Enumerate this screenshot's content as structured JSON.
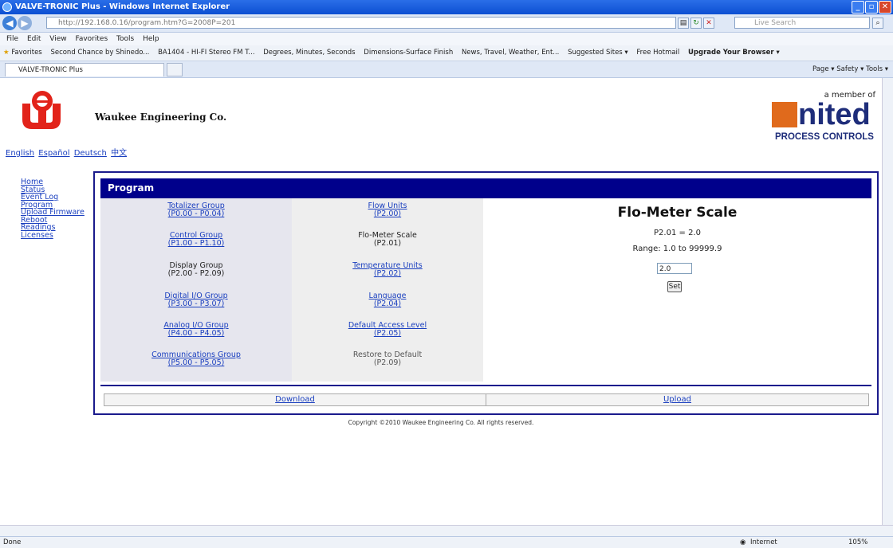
{
  "window": {
    "title": "VALVE-TRONIC Plus - Windows Internet Explorer",
    "address": "http://192.168.0.16/program.htm?G=2008P=201",
    "search_placeholder": "Live Search"
  },
  "menu": [
    "File",
    "Edit",
    "View",
    "Favorites",
    "Tools",
    "Help"
  ],
  "favorites": {
    "label": "Favorites",
    "items": [
      "Second Chance by Shinedo...",
      "BA1404 - HI-FI Stereo FM T...",
      "Degrees, Minutes, Seconds",
      "Dimensions-Surface Finish",
      "News, Travel, Weather, Ent...",
      "Suggested Sites ▾",
      "Free Hotmail",
      "Upgrade Your Browser ▾"
    ]
  },
  "tab": {
    "label": "VALVE-TRONIC Plus"
  },
  "command_bar": "Page ▾  Safety ▾  Tools ▾",
  "header": {
    "company": "Waukee Engineering Co.",
    "member_of": "a member of",
    "partner_word": "nited",
    "partner_sub": "PROCESS CONTROLS",
    "languages": [
      "English",
      "Español",
      "Deutsch",
      "中文"
    ]
  },
  "sidenav": [
    "Home",
    "Status",
    "Event Log",
    "Program",
    "Upload Firmware",
    "Reboot",
    "Readings",
    "Licenses"
  ],
  "program": {
    "title": "Program",
    "groups": [
      {
        "name": "Totalizer Group",
        "range": "(P0.00 - P0.04)"
      },
      {
        "name": "Control Group",
        "range": "(P1.00 - P1.10)"
      },
      {
        "name": "Display Group",
        "range": "(P2.00 - P2.09)"
      },
      {
        "name": "Digital I/O Group",
        "range": "(P3.00 - P3.07)"
      },
      {
        "name": "Analog I/O Group",
        "range": "(P4.00 - P4.05)"
      },
      {
        "name": "Communications Group",
        "range": "(P5.00 - P5.05)"
      }
    ],
    "params": [
      {
        "name": "Flow Units",
        "code": "(P2.00)"
      },
      {
        "name": "Flo-Meter Scale",
        "code": "(P2.01)"
      },
      {
        "name": "Temperature Units",
        "code": "(P2.02)"
      },
      {
        "name": "Language",
        "code": "(P2.04)"
      },
      {
        "name": "Default Access Level",
        "code": "(P2.05)"
      },
      {
        "name": "Restore to Default",
        "code": "(P2.09)"
      }
    ],
    "detail": {
      "title": "Flo-Meter Scale",
      "value_line": "P2.01 = 2.0",
      "range_line": "Range: 1.0 to 99999.9",
      "input_value": "2.0",
      "set_label": "Set"
    },
    "download_label": "Download",
    "upload_label": "Upload"
  },
  "copyright": "Copyright ©2010 Waukee Engineering Co. All rights reserved.",
  "status": {
    "left": "Done",
    "zone": "Internet",
    "zoom": "105%"
  }
}
